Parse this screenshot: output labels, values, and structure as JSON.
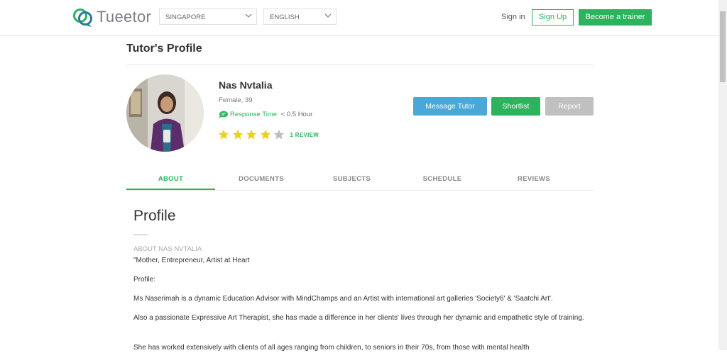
{
  "header": {
    "logo_text": "Tueetor",
    "country_select": "SINGAPORE",
    "language_select": "ENGLISH",
    "signin_label": "Sign in",
    "signup_label": "Sign Up",
    "trainer_label": "Become a trainer",
    "brand_color": "#2bb35e"
  },
  "page": {
    "title": "Tutor's Profile"
  },
  "tutor": {
    "name": "Nas Nvtalia",
    "meta": "Female, 39",
    "response_label": "Response Time:",
    "response_value": "< 0.5 Hour",
    "rating": 4,
    "rating_max": 5,
    "review_count_label": "1 REVIEW"
  },
  "actions": {
    "message_label": "Message Tutor",
    "message_color": "#4aa8d8",
    "shortlist_label": "Shortlist",
    "shortlist_color": "#2bb35e",
    "report_label": "Report",
    "report_color": "#c0c0c0"
  },
  "tabs": [
    {
      "label": "ABOUT",
      "active": true
    },
    {
      "label": "DOCUMENTS",
      "active": false
    },
    {
      "label": "SUBJECTS",
      "active": false
    },
    {
      "label": "SCHEDULE",
      "active": false
    },
    {
      "label": "REVIEWS",
      "active": false
    }
  ],
  "about": {
    "heading": "Profile",
    "section_label": "ABOUT NAS NVTALIA",
    "paragraphs": [
      "\"Mother, Entrepreneur, Artist at Heart",
      "Profile:",
      "Ms Naserimah is a dynamic Education Advisor with MindChamps and an Artist with international art galleries 'Society6' & 'Saatchi Art'.",
      "Also a passionate Expressive Art Therapist, she has made a difference in her clients' lives through her dynamic and empathetic style of training.",
      "She has worked extensively with clients of all ages ranging from children, to seniors in their 70s, from those with mental health"
    ]
  }
}
